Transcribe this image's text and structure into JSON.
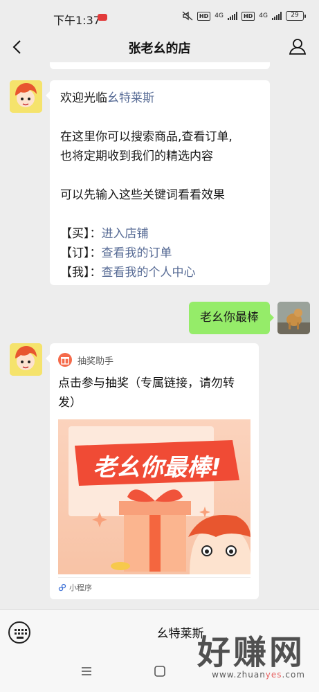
{
  "status_bar": {
    "time": "下午1:37",
    "hd1": "HD",
    "hd2": "HD",
    "net1": "4G",
    "net2": "4G",
    "battery": "29"
  },
  "header": {
    "title": "张老幺的店"
  },
  "welcome_message": {
    "intro_prefix": "欢迎光临",
    "intro_link": "幺特莱斯",
    "line1": "在这里你可以搜索商品,查看订单,",
    "line2": "也将定期收到我们的精选内容",
    "line3": "可以先输入这些关键词看看效果",
    "keywords": [
      {
        "key": "【买】：",
        "link": "进入店铺"
      },
      {
        "key": "【订】：",
        "link": "查看我的订单"
      },
      {
        "key": "【我】：",
        "link": "查看我的个人中心"
      }
    ]
  },
  "my_message": {
    "text": "老幺你最棒"
  },
  "mini_program_card": {
    "app_name": "抽奖助手",
    "description": "点击参与抽奖（专属链接，请勿转发）",
    "banner_text": "老幺你最棒!",
    "footer": "小程序"
  },
  "bottom_bar": {
    "menu_label": "幺特莱斯"
  },
  "watermark": {
    "big": "好赚网",
    "url_prefix": "www.zhuan",
    "url_red": "yes",
    "url_suffix": ".com"
  },
  "colors": {
    "link": "#576b95",
    "my_bubble": "#95ec69",
    "background": "#ededed"
  }
}
